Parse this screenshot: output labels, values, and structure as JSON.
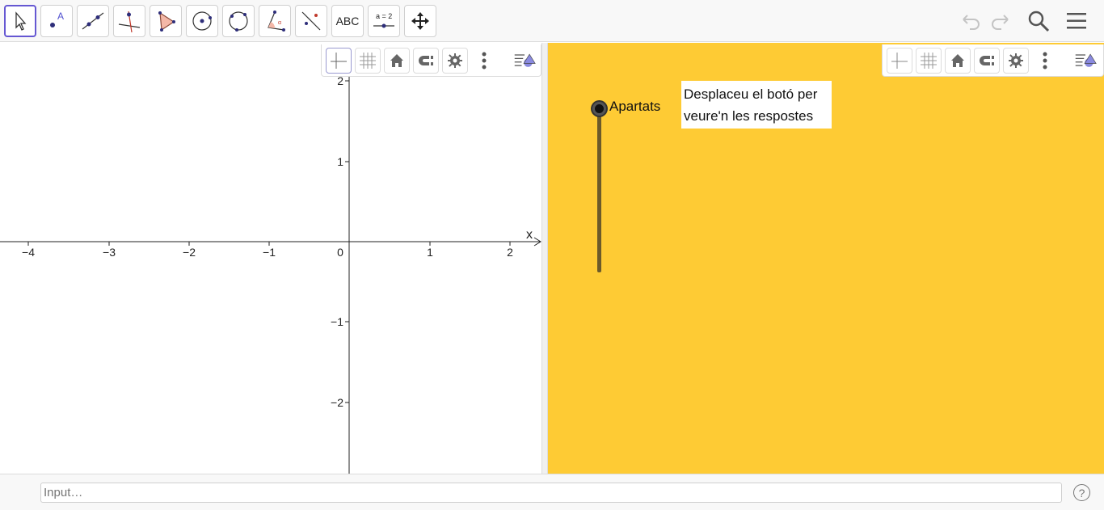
{
  "toolbar": {
    "tools": [
      {
        "name": "move-tool",
        "icon": "arrow-cursor-icon"
      },
      {
        "name": "point-tool",
        "icon": "point-icon"
      },
      {
        "name": "line-tool",
        "icon": "line-icon"
      },
      {
        "name": "perpendicular-tool",
        "icon": "perpendicular-icon"
      },
      {
        "name": "polygon-tool",
        "icon": "polygon-icon"
      },
      {
        "name": "circle-tool",
        "icon": "circle-center-icon"
      },
      {
        "name": "circle-three-points-tool",
        "icon": "circle-three-points-icon"
      },
      {
        "name": "angle-tool",
        "icon": "angle-icon"
      },
      {
        "name": "reflect-tool",
        "icon": "reflect-icon"
      },
      {
        "name": "text-tool",
        "icon": "text-icon",
        "label": "ABC"
      },
      {
        "name": "slider-tool",
        "icon": "slider-icon",
        "label": "a = 2"
      },
      {
        "name": "move-graphics-tool",
        "icon": "move-arrows-icon"
      }
    ],
    "right_buttons": [
      "undo-icon",
      "redo-icon",
      "search-icon",
      "menu-icon"
    ]
  },
  "graphics1": {
    "style_bar": [
      "axes-icon",
      "grid-icon",
      "home-icon",
      "snap-icon",
      "gear-icon",
      "more-vert-icon",
      "view-menu-icon"
    ],
    "x_axis_name": "x",
    "x_ticks": [
      "−4",
      "−3",
      "−2",
      "−1",
      "0",
      "1",
      "2"
    ],
    "y_ticks": [
      "2",
      "1",
      "−1",
      "−2"
    ]
  },
  "graphics2": {
    "background": "#fecb34",
    "style_bar": [
      "axes-icon",
      "grid-icon",
      "home-icon",
      "snap-icon",
      "gear-icon",
      "more-vert-icon",
      "view-menu-icon"
    ],
    "slider_label": "Apartats",
    "slider_value": 0,
    "info_line1": "Desplaceu el botó per",
    "info_line2": "veure'n les respostes"
  },
  "input_bar": {
    "placeholder": "Input…",
    "help": "?"
  },
  "colors": {
    "accent": "#6557d2",
    "yellow": "#fecb34"
  }
}
